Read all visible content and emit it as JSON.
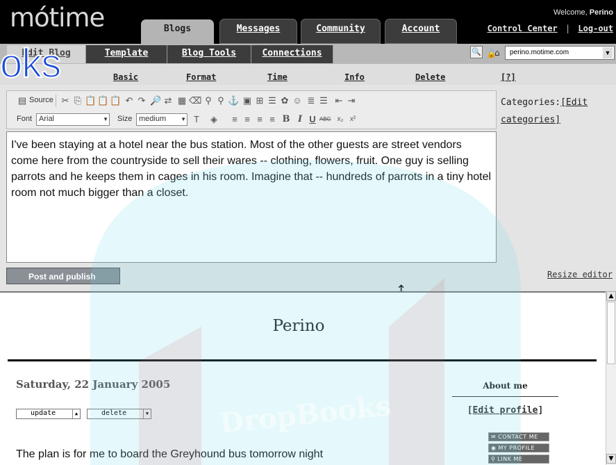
{
  "header": {
    "logo": "mótime",
    "welcome_prefix": "Welcome,",
    "welcome_user": "Perino",
    "control_center": "Control Center",
    "separator": "|",
    "logout": "Log-out"
  },
  "main_tabs": [
    {
      "label": "Blogs",
      "active": true
    },
    {
      "label": "Messages",
      "active": false
    },
    {
      "label": "Community",
      "active": false
    },
    {
      "label": "Account",
      "active": false
    }
  ],
  "sub_tabs": [
    {
      "label": "Edit Blog",
      "active": true
    },
    {
      "label": "Template",
      "active": false
    },
    {
      "label": "Blog Tools",
      "active": false
    },
    {
      "label": "Connections",
      "active": false
    }
  ],
  "site_select": {
    "value": "perino.motime.com",
    "arrow": "▼"
  },
  "nav3": [
    "Basic",
    "Format",
    "Time",
    "Info",
    "Delete",
    "[?]"
  ],
  "toolbar": {
    "source_label": "Source",
    "font_label": "Font",
    "font_value": "Arial",
    "size_label": "Size",
    "size_value": "medium"
  },
  "editor": {
    "text": "I've been staying at a hotel near the bus station. Most of the other guests are street vendors come here from the countryside to sell their wares -- clothing, flowers, fruit. One guy is selling parrots and he keeps them in cages in his room. Imagine that -- hundreds of parrots in a tiny hotel room not much bigger than a closet."
  },
  "categories": {
    "label": "Categories:",
    "edit_a": "[Edit",
    "edit_b": "categories]"
  },
  "post_button": "Post and publish",
  "resize_editor": "Resize editor",
  "preview": {
    "blog_title": "Perino",
    "post_date": "Saturday, 22 January 2005",
    "update_label": "update",
    "delete_label": "delete",
    "about_me": "About me",
    "edit_profile_open": "[",
    "edit_profile_link": "Edit profile",
    "edit_profile_close": "]",
    "badges": [
      "CONTACT ME",
      "MY PROFILE",
      "LINK ME"
    ],
    "post_body": "The plan is for me to board the Greyhound bus tomorrow night"
  },
  "watermark": {
    "text": "oks",
    "brand": "DropBooks"
  },
  "colors": {
    "header_bg": "#000000",
    "subnav_bg": "#b8b8b8",
    "watermark_blue": "#1a4bd9",
    "post_button": "#8a9096"
  }
}
